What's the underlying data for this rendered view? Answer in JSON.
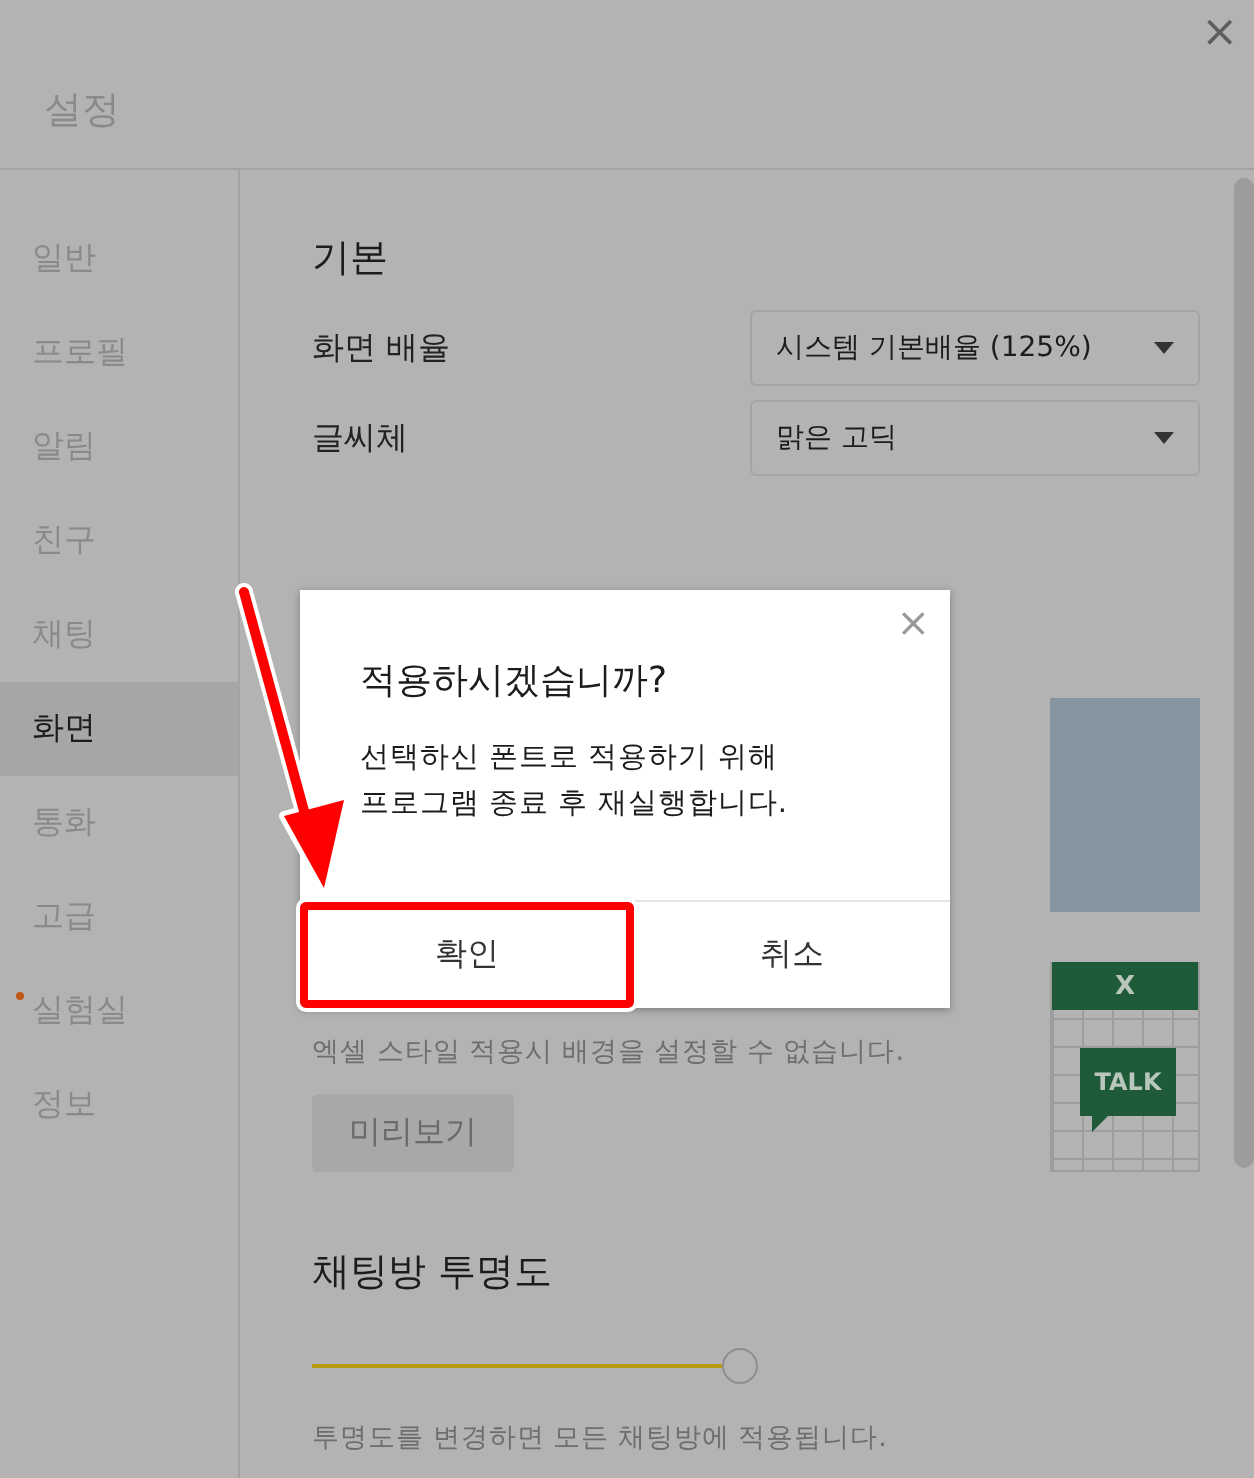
{
  "window": {
    "title": "설정",
    "close": "×"
  },
  "sidebar": {
    "items": [
      {
        "label": "일반",
        "selected": false,
        "new": false
      },
      {
        "label": "프로필",
        "selected": false,
        "new": false
      },
      {
        "label": "알림",
        "selected": false,
        "new": false
      },
      {
        "label": "친구",
        "selected": false,
        "new": false
      },
      {
        "label": "채팅",
        "selected": false,
        "new": false
      },
      {
        "label": "화면",
        "selected": true,
        "new": false
      },
      {
        "label": "통화",
        "selected": false,
        "new": false
      },
      {
        "label": "고급",
        "selected": false,
        "new": false
      },
      {
        "label": "실험실",
        "selected": false,
        "new": true
      },
      {
        "label": "정보",
        "selected": false,
        "new": false
      }
    ]
  },
  "basic": {
    "heading": "기본",
    "settings": [
      {
        "label": "화면 배율",
        "value": "시스템 기본배율 (125%)"
      },
      {
        "label": "글씨체",
        "value": "맑은 고딕"
      }
    ]
  },
  "theme": {
    "excel_note": "엑셀 스타일 적용시 배경을 설정할 수 없습니다.",
    "preview_button": "미리보기",
    "excel_preview": {
      "header": "X",
      "bubble": "TALK"
    }
  },
  "transparency": {
    "heading": "채팅방 투명도",
    "level": 1,
    "note": "투명도를 변경하면 모든 채팅방에 적용됩니다."
  },
  "dialog": {
    "title": "적용하시겠습니까?",
    "message": "선택하신 폰트로 적용하기 위해 프로그램 종료 후 재실행합니다.",
    "buttons": [
      {
        "label": "확인",
        "highlighted": true
      },
      {
        "label": "취소",
        "highlighted": false
      }
    ]
  },
  "annotations": [
    {
      "kind": "arrow"
    }
  ]
}
